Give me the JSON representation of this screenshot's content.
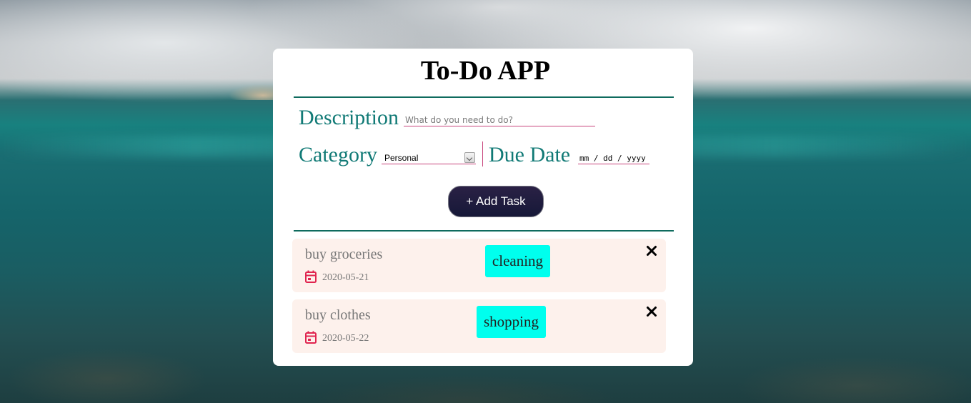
{
  "app": {
    "title": "To-Do APP"
  },
  "form": {
    "description_label": "Description",
    "description_placeholder": "What do you need to do?",
    "description_value": "",
    "category_label": "Category",
    "category_selected": "Personal",
    "due_date_label": "Due Date",
    "due_date_placeholder": "mm / dd / yyyy",
    "add_button_label": "+ Add Task"
  },
  "tasks": [
    {
      "title": "buy groceries",
      "date": "2020-05-21",
      "category": "cleaning",
      "icons": [
        "calendar-icon",
        "close-icon"
      ]
    },
    {
      "title": "buy clothes",
      "date": "2020-05-22",
      "category": "shopping",
      "icons": [
        "calendar-icon",
        "close-icon"
      ]
    }
  ],
  "colors": {
    "label": "#117a76",
    "divider": "#0f6b5e",
    "input_underline": "#c8467d",
    "button_bg": "#1c1b3f",
    "task_bg": "#fdf1ec",
    "tag_bg": "#00ffee",
    "calendar_icon": "#e0244f"
  }
}
